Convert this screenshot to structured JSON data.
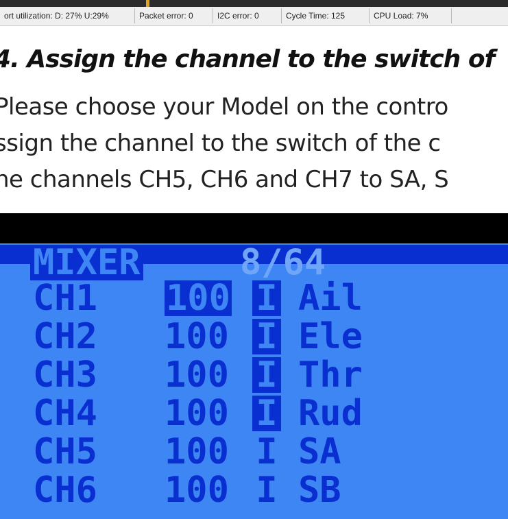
{
  "status_bar": {
    "items": [
      "ort utilization: D: 27% U:29%",
      "Packet error: 0",
      "I2C error: 0",
      "Cycle Time: 125",
      "CPU Load: 7%"
    ]
  },
  "doc": {
    "heading": "4. Assign the channel to the switch of",
    "lines": [
      "Please choose your Model on the contro",
      "ssign the channel to the switch of the c",
      "he channels CH5, CH6 and CH7 to SA, S"
    ]
  },
  "lcd": {
    "title": "MIXER",
    "page": "8/64",
    "rows": [
      {
        "ch": "CH1",
        "weight": "100",
        "indicator": "I",
        "source": "Ail"
      },
      {
        "ch": "CH2",
        "weight": "100",
        "indicator": "I",
        "source": "Ele"
      },
      {
        "ch": "CH3",
        "weight": "100",
        "indicator": "I",
        "source": "Thr"
      },
      {
        "ch": "CH4",
        "weight": "100",
        "indicator": "I",
        "source": "Rud"
      },
      {
        "ch": "CH5",
        "weight": "100",
        "indicator": "I",
        "source": "SA"
      },
      {
        "ch": "CH6",
        "weight": "100",
        "indicator": "I",
        "source": "SB"
      }
    ]
  },
  "colors": {
    "lcd_background": "#3f86f5",
    "lcd_foreground": "#0a2fd0",
    "accent": "#e0a21b"
  }
}
